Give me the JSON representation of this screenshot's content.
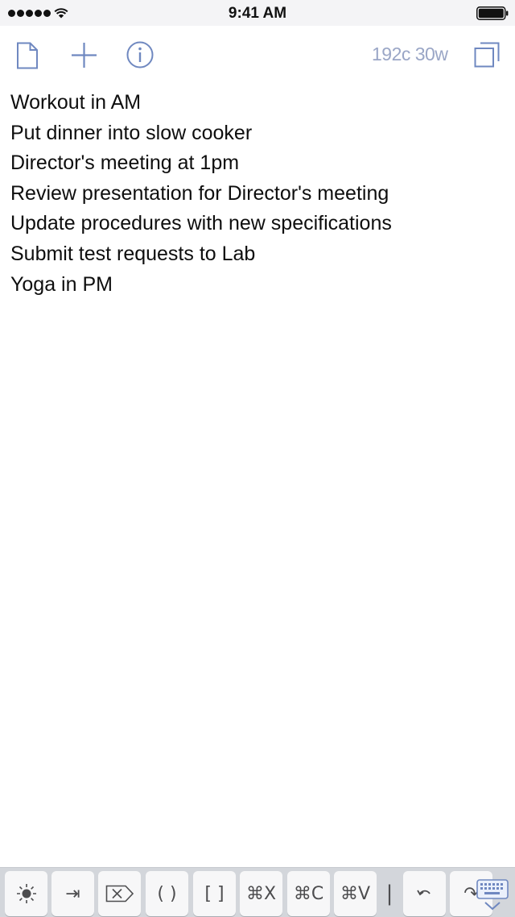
{
  "status_bar": {
    "time": "9:41 AM",
    "signal_icon": "signal-dots-icon",
    "wifi_icon": "wifi-icon",
    "battery_icon": "battery-icon"
  },
  "toolbar": {
    "icons": [
      "document-icon",
      "plus-icon",
      "info-icon",
      "fullscreen-icon"
    ],
    "counter": "192c 30w",
    "accent_color": "#6f88c0"
  },
  "document": {
    "lines": [
      "Workout in AM",
      "Put dinner into slow cooker",
      "Director's meeting at 1pm",
      "Review presentation for Director's meeting",
      "Update procedures with new specifications",
      "Submit test requests to Lab",
      "Yoga in PM"
    ]
  },
  "accessory_bar": {
    "keys": [
      {
        "name": "brightness-key",
        "label": "☀"
      },
      {
        "name": "tab-key",
        "label": "⇥"
      },
      {
        "name": "delete-key",
        "label": "⌦"
      },
      {
        "name": "parentheses-key",
        "label": "( )"
      },
      {
        "name": "brackets-key",
        "label": "[ ]"
      },
      {
        "name": "cut-key",
        "label": "⌘X"
      },
      {
        "name": "copy-key",
        "label": "⌘C"
      },
      {
        "name": "paste-key",
        "label": "⌘V"
      },
      {
        "name": "undo-key",
        "label": "⤺"
      },
      {
        "name": "redo-key",
        "label": "↷"
      }
    ],
    "separator": "|",
    "dismiss_icon": "keyboard-dismiss-icon"
  }
}
